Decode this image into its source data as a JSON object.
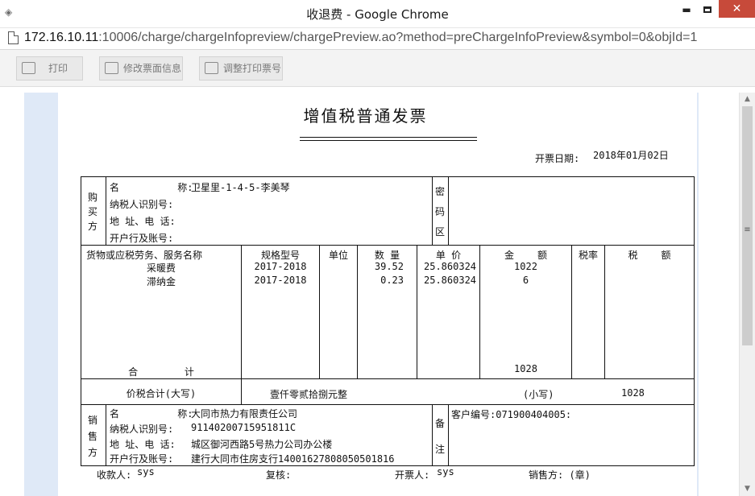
{
  "window": {
    "title": "收退费 - Google Chrome",
    "min": "▬",
    "close": "✕"
  },
  "address": {
    "host": "172.16.10.11",
    "rest": ":10006/charge/chargeInfopreview/chargePreview.ao?method=preChargeInfoPreview&symbol=0&objId=1"
  },
  "toolbar": {
    "print": "打印",
    "edit_face": "修改票面信息",
    "adjust_no": "调整打印票号"
  },
  "invoice": {
    "title": "增值税普通发票",
    "date_label": "开票日期:",
    "date": "2018年01月02日",
    "buyer": {
      "section": "购买方",
      "name_label": "名          称:",
      "name": "卫星里-1-4-5-李美琴",
      "tax_label": "纳税人识别号:",
      "addr_label": "地 址、电 话:",
      "bank_label": "开户行及账号:",
      "cipher_label": "密码区"
    },
    "headers": {
      "goods": "货物或应税劳务、服务名称",
      "spec": "规格型号",
      "unit": "单位",
      "qty": "数 量",
      "price": "单 价",
      "amount": "金    额",
      "rate": "税率",
      "tax": "税    额"
    },
    "items": [
      {
        "name": "采暖费",
        "spec": "2017-2018",
        "qty": "39.52",
        "price": "25.860324",
        "amount": "1022"
      },
      {
        "name": "滞纳金",
        "spec": "2017-2018",
        "qty": "0.23",
        "price": "25.860324",
        "amount": "6"
      }
    ],
    "total_label": "合        计",
    "total_amount": "1028",
    "sum_label": "价税合计(大写)",
    "sum_words": "壹仟零贰拾捌元整",
    "small_label": "(小写)",
    "small_amount": "1028",
    "seller": {
      "section": "销售方",
      "name_label": "名          称:",
      "name": "大同市热力有限责任公司",
      "tax_label": "纳税人识别号:",
      "tax_id": "91140200715951811C",
      "addr_label": "地 址、电 话:",
      "addr": "城区御河西路5号热力公司办公楼",
      "bank_label": "开户行及账号:",
      "bank": "建行大同市住房支行14001627808050501816",
      "remark_label": "备注",
      "remark": "客户编号:071900404005:"
    },
    "footer": {
      "payee_label": "收款人:",
      "payee": "sys",
      "review_label": "复核:",
      "drawer_label": "开票人:",
      "drawer": "sys",
      "seller_label": "销售方: (章)"
    }
  }
}
